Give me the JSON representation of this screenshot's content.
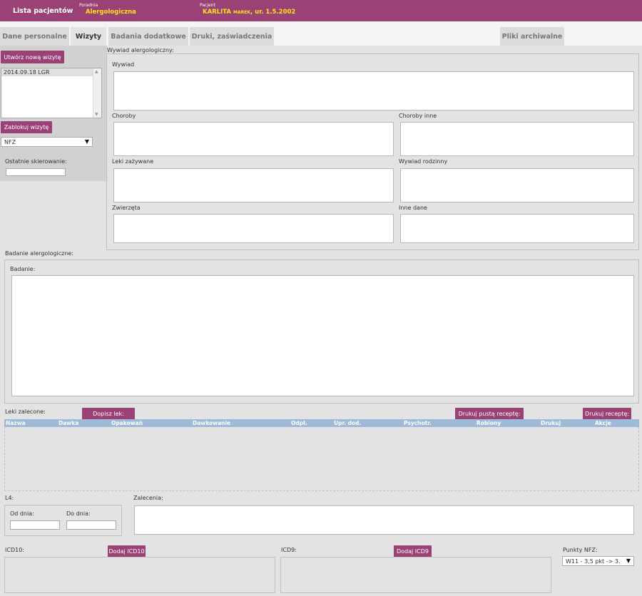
{
  "header": {
    "app_title": "Lista pacjentów",
    "poradnia_label": "Poradnia",
    "poradnia_value": "Alergologiczna",
    "pacjent_label": "Pacjent",
    "pacjent_surname": "KARLITA",
    "pacjent_firstname": "MAREK",
    "pacjent_rest": ", ur. 1.5.2002"
  },
  "tabs": [
    {
      "label": "Dane personalne"
    },
    {
      "label": "Wizyty"
    },
    {
      "label": "Badania dodatkowe"
    },
    {
      "label": "Druki, zaświadczenia"
    },
    {
      "label": "Pliki archiwalne"
    }
  ],
  "left": {
    "new_visit_button": "Utwórz nową wizytę",
    "visits": [
      "2014.09.18  LGR"
    ],
    "lock_button": "Zablokuj wizytę",
    "payer_select": "NFZ",
    "last_referral_label": "Ostatnie skierowanie:",
    "last_referral_value": ""
  },
  "interview": {
    "legend": "Wywiad alergologiczny:",
    "wywiad": "Wywiad",
    "choroby": "Choroby",
    "choroby_inne": "Choroby inne",
    "leki": "Leki zażywane",
    "rodzinny": "Wywiad rodzinny",
    "zwierzeta": "Zwierzęta",
    "inne": "Inne dane"
  },
  "exam": {
    "legend": "Badanie alergologiczne:",
    "badanie": "Badanie:"
  },
  "drugs": {
    "label": "Leki zalecone:",
    "add_button": "Dopisz lek:",
    "print_empty_button": "Drukuj pustą receptę:",
    "print_button": "Drukuj receptę:",
    "columns": [
      "Nazwa",
      "Dawka",
      "Opakowań",
      "Dawkowanie",
      "Odpł.",
      "Upr. dod.",
      "Psychotr.",
      "Robiony",
      "Drukuj",
      "Akcje"
    ]
  },
  "l4": {
    "legend": "L4:",
    "from_label": "Od dnia:",
    "to_label": "Do dnia:",
    "from_value": "",
    "to_value": ""
  },
  "recommendations": {
    "label": "Zalecenia:"
  },
  "icd10": {
    "label": "ICD10:",
    "add_button": "Dodaj ICD10"
  },
  "icd9": {
    "label": "ICD9:",
    "add_button": "Dodaj ICD9"
  },
  "nfz_points": {
    "label": "Punkty NFZ:",
    "select_value": "W11 - 3,5 pkt -> 3."
  }
}
